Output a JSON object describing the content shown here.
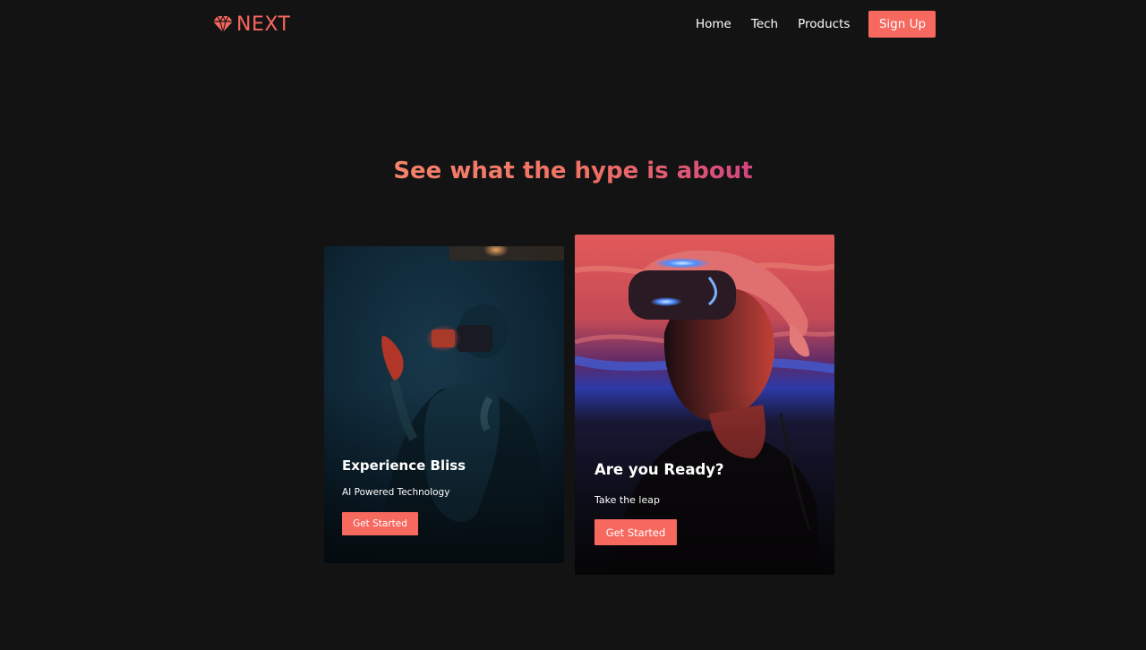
{
  "brand": {
    "name": "NEXT",
    "icon": "gem-icon",
    "color": "#f7685f"
  },
  "nav": {
    "links": [
      {
        "label": "Home"
      },
      {
        "label": "Tech"
      },
      {
        "label": "Products"
      }
    ],
    "signup_label": "Sign Up"
  },
  "hero": {
    "title": "See what the hype is about"
  },
  "cards": [
    {
      "title": "Experience Bliss",
      "subtitle": "AI Powered Technology",
      "button_label": "Get Started",
      "image": "vr-headset-woman-photo"
    },
    {
      "title": "Are you Ready?",
      "subtitle": "Take the leap",
      "button_label": "Get Started",
      "image": "vr-headset-man-photo"
    }
  ],
  "colors": {
    "background": "#131313",
    "accent": "#f7685f",
    "title_gradient_start": "#f5826b",
    "title_gradient_end": "#d2457f"
  }
}
